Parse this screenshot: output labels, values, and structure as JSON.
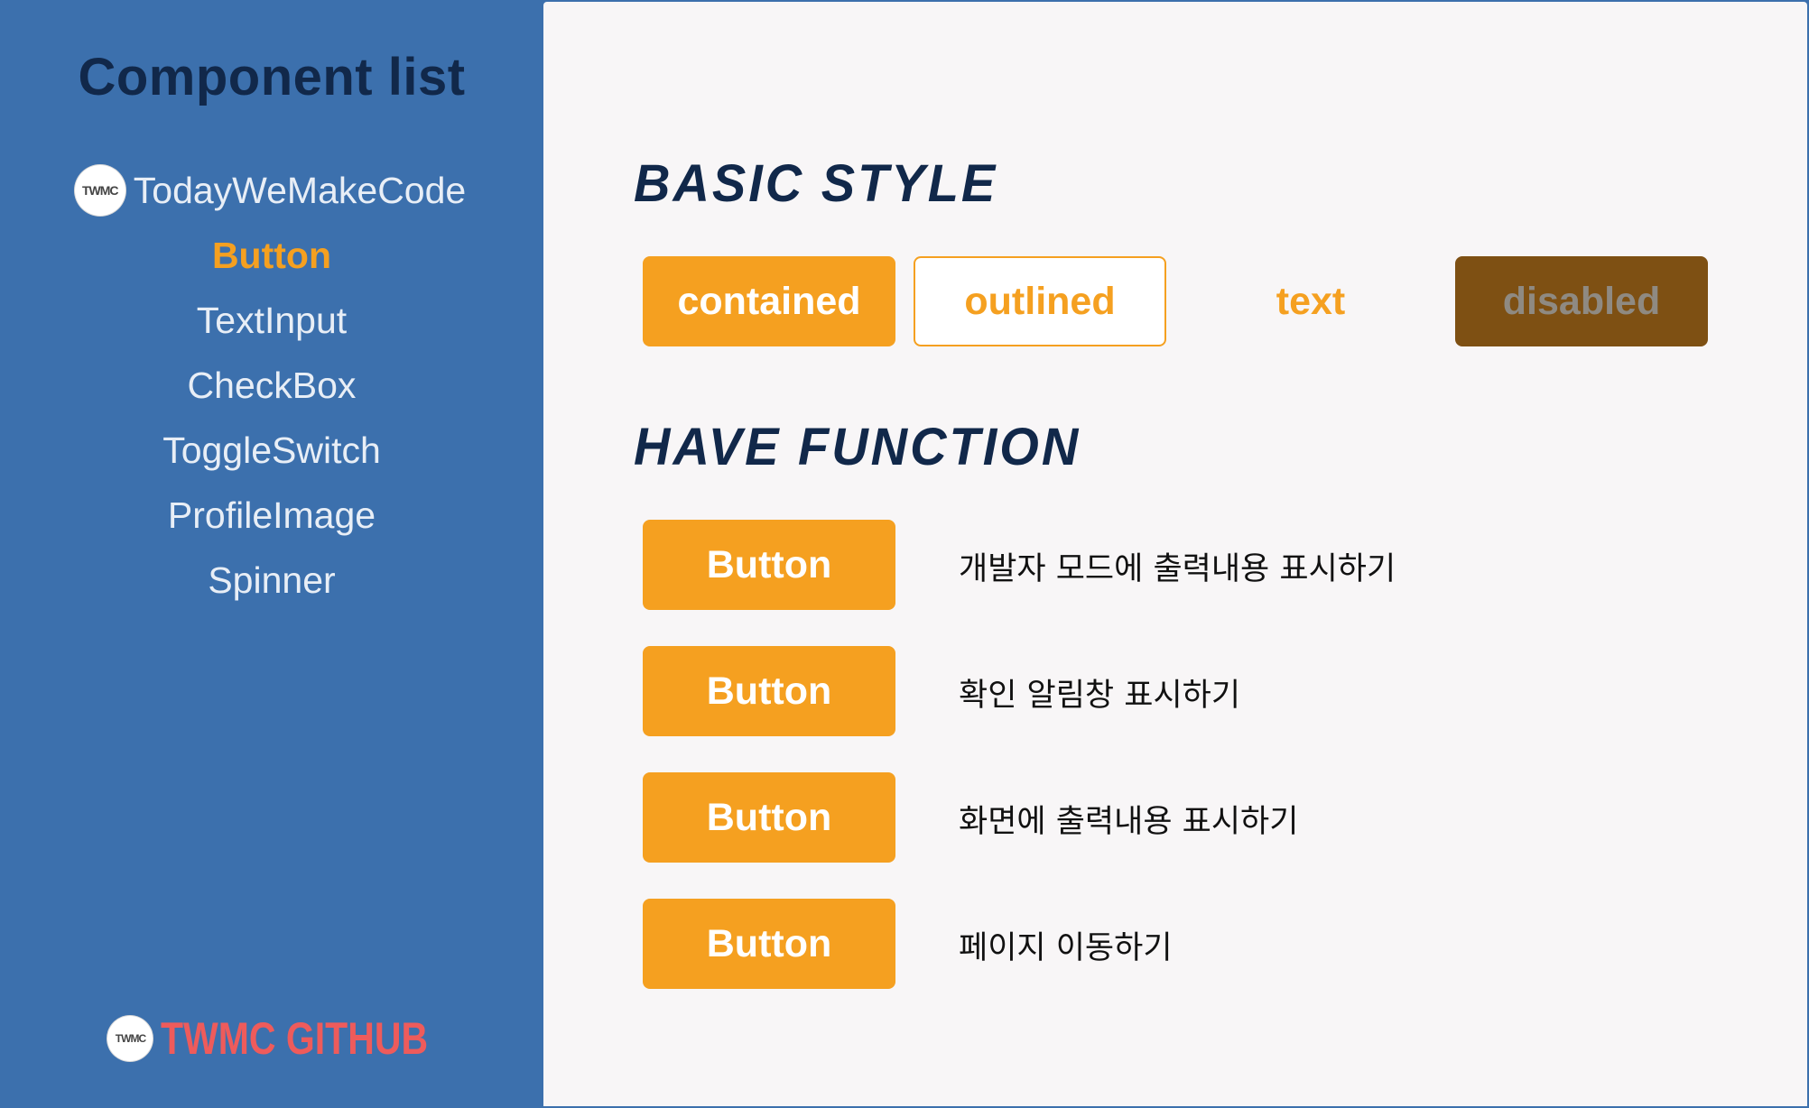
{
  "sidebar": {
    "title": "Component list",
    "logo_text": "TWMC",
    "items": [
      {
        "label": "TodayWeMakeCode",
        "active": false
      },
      {
        "label": "Button",
        "active": true
      },
      {
        "label": "TextInput",
        "active": false
      },
      {
        "label": "CheckBox",
        "active": false
      },
      {
        "label": "ToggleSwitch",
        "active": false
      },
      {
        "label": "ProfileImage",
        "active": false
      },
      {
        "label": "Spinner",
        "active": false
      }
    ],
    "github_label": "TWMC GITHUB"
  },
  "main": {
    "basic_style": {
      "title": "Basic style",
      "buttons": {
        "contained": "contained",
        "outlined": "outlined",
        "text": "text",
        "disabled": "disabled"
      }
    },
    "have_function": {
      "title": "Have function",
      "rows": [
        {
          "button": "Button",
          "description": "개발자 모드에 출력내용 표시하기"
        },
        {
          "button": "Button",
          "description": "확인 알림창 표시하기"
        },
        {
          "button": "Button",
          "description": "화면에 출력내용 표시하기"
        },
        {
          "button": "Button",
          "description": "페이지 이동하기"
        }
      ]
    }
  },
  "colors": {
    "sidebar_bg": "#3c70ad",
    "title_navy": "#11284a",
    "accent_orange": "#f5a020",
    "disabled_brown": "#7e5013",
    "github_red": "#ee5b5b",
    "main_bg": "#f8f6f7"
  }
}
